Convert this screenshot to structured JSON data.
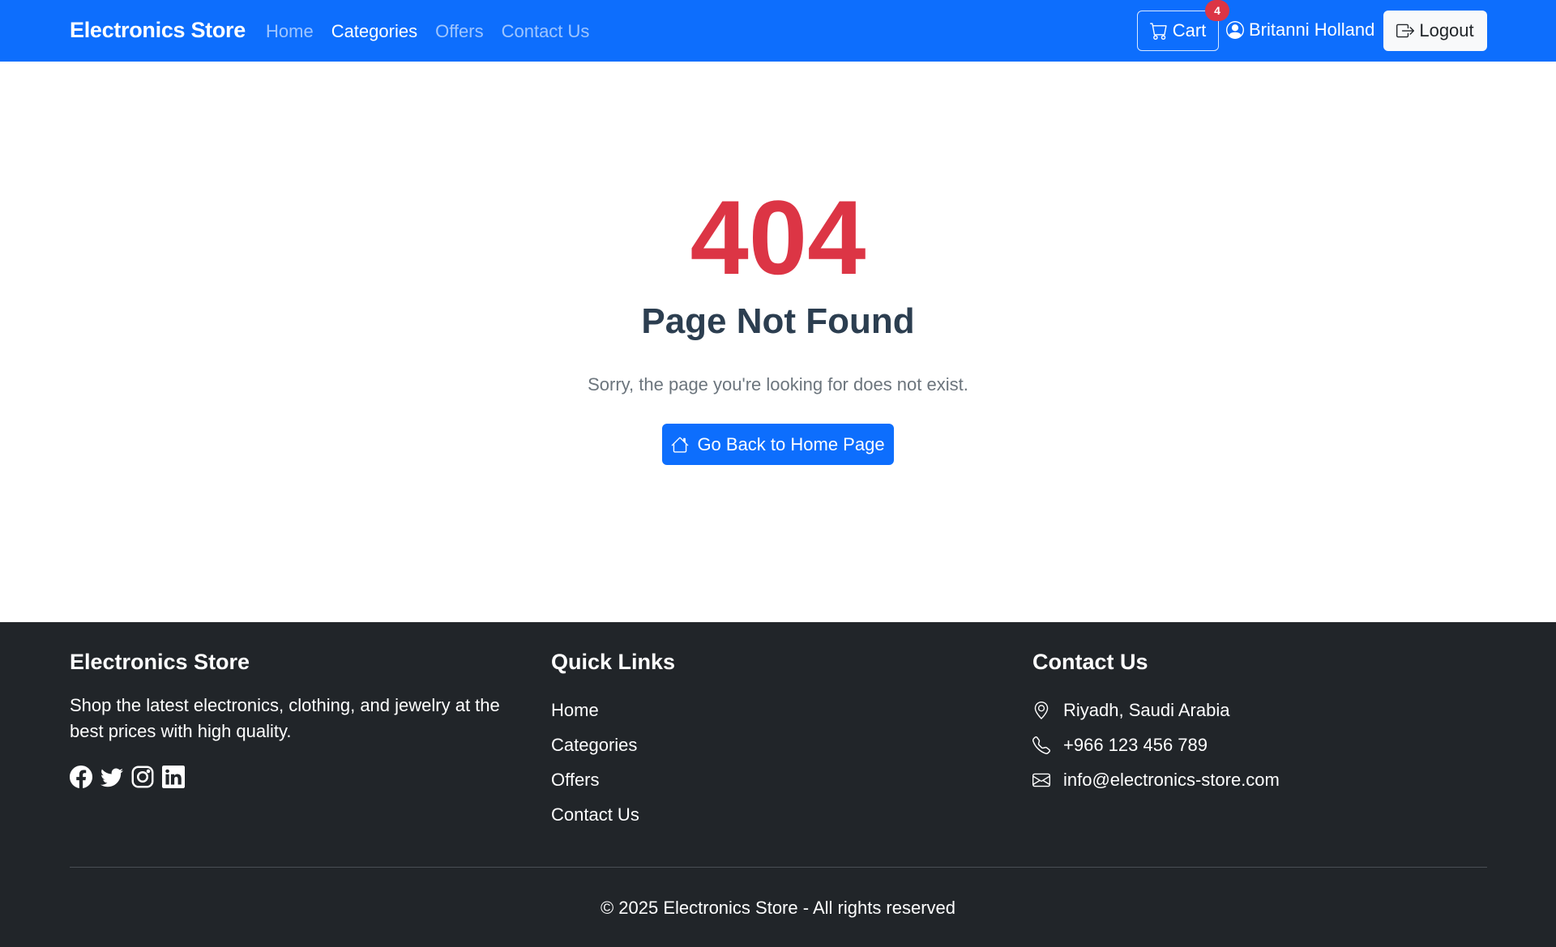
{
  "navbar": {
    "brand": "Electronics Store",
    "links": [
      {
        "label": "Home",
        "active": false
      },
      {
        "label": "Categories",
        "active": true
      },
      {
        "label": "Offers",
        "active": false
      },
      {
        "label": "Contact Us",
        "active": false
      }
    ],
    "cart_label": "Cart",
    "cart_count": "4",
    "user_name": "Britanni Holland",
    "logout_label": "Logout"
  },
  "main": {
    "error_code": "404",
    "title": "Page Not Found",
    "message": "Sorry, the page you're looking for does not exist.",
    "home_button": "Go Back to Home Page"
  },
  "footer": {
    "about": {
      "title": "Electronics Store",
      "description": "Shop the latest electronics, clothing, and jewelry at the best prices with high quality.",
      "socials": [
        "facebook-icon",
        "twitter-icon",
        "instagram-icon",
        "linkedin-icon"
      ]
    },
    "quick_links": {
      "title": "Quick Links",
      "items": [
        "Home",
        "Categories",
        "Offers",
        "Contact Us"
      ]
    },
    "contact": {
      "title": "Contact Us",
      "address": "Riyadh, Saudi Arabia",
      "phone": "+966 123 456 789",
      "email": "info@electronics-store.com"
    },
    "copyright": "© 2025 Electronics Store - All rights reserved"
  },
  "colors": {
    "primary": "#0d6efd",
    "danger": "#dc3545",
    "footer_bg": "#212529",
    "title": "#2c3e50"
  }
}
